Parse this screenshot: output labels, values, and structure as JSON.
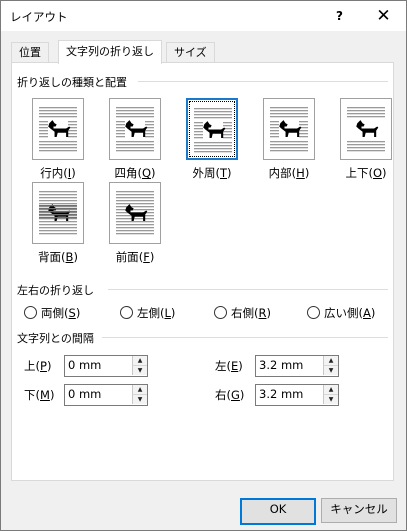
{
  "window": {
    "title": "レイアウト",
    "help": "?",
    "close": "✕"
  },
  "tabs": [
    "位置",
    "文字列の折り返し",
    "サイズ"
  ],
  "wrap_group": {
    "title": "折り返しの種類と配置",
    "options": [
      {
        "label": "行内",
        "key": "I",
        "icon": "inline-icon"
      },
      {
        "label": "四角",
        "key": "Q",
        "icon": "square-icon"
      },
      {
        "label": "外周",
        "key": "T",
        "icon": "tight-icon",
        "selected": true
      },
      {
        "label": "内部",
        "key": "H",
        "icon": "through-icon"
      },
      {
        "label": "上下",
        "key": "O",
        "icon": "top-bottom-icon"
      },
      {
        "label": "背面",
        "key": "B",
        "icon": "behind-text-icon"
      },
      {
        "label": "前面",
        "key": "F",
        "icon": "in-front-icon"
      }
    ]
  },
  "side_group": {
    "title": "左右の折り返し",
    "radios": [
      {
        "label": "両側",
        "key": "S"
      },
      {
        "label": "左側",
        "key": "L"
      },
      {
        "label": "右側",
        "key": "R"
      },
      {
        "label": "広い側",
        "key": "A"
      }
    ]
  },
  "distance_group": {
    "title": "文字列との間隔",
    "fields": [
      {
        "label": "上",
        "key": "P",
        "value": "0 mm"
      },
      {
        "label": "下",
        "key": "M",
        "value": "0 mm"
      },
      {
        "label": "左",
        "key": "E",
        "value": "3.2 mm"
      },
      {
        "label": "右",
        "key": "G",
        "value": "3.2 mm"
      }
    ]
  },
  "buttons": {
    "ok": "OK",
    "cancel": "キャンセル"
  }
}
